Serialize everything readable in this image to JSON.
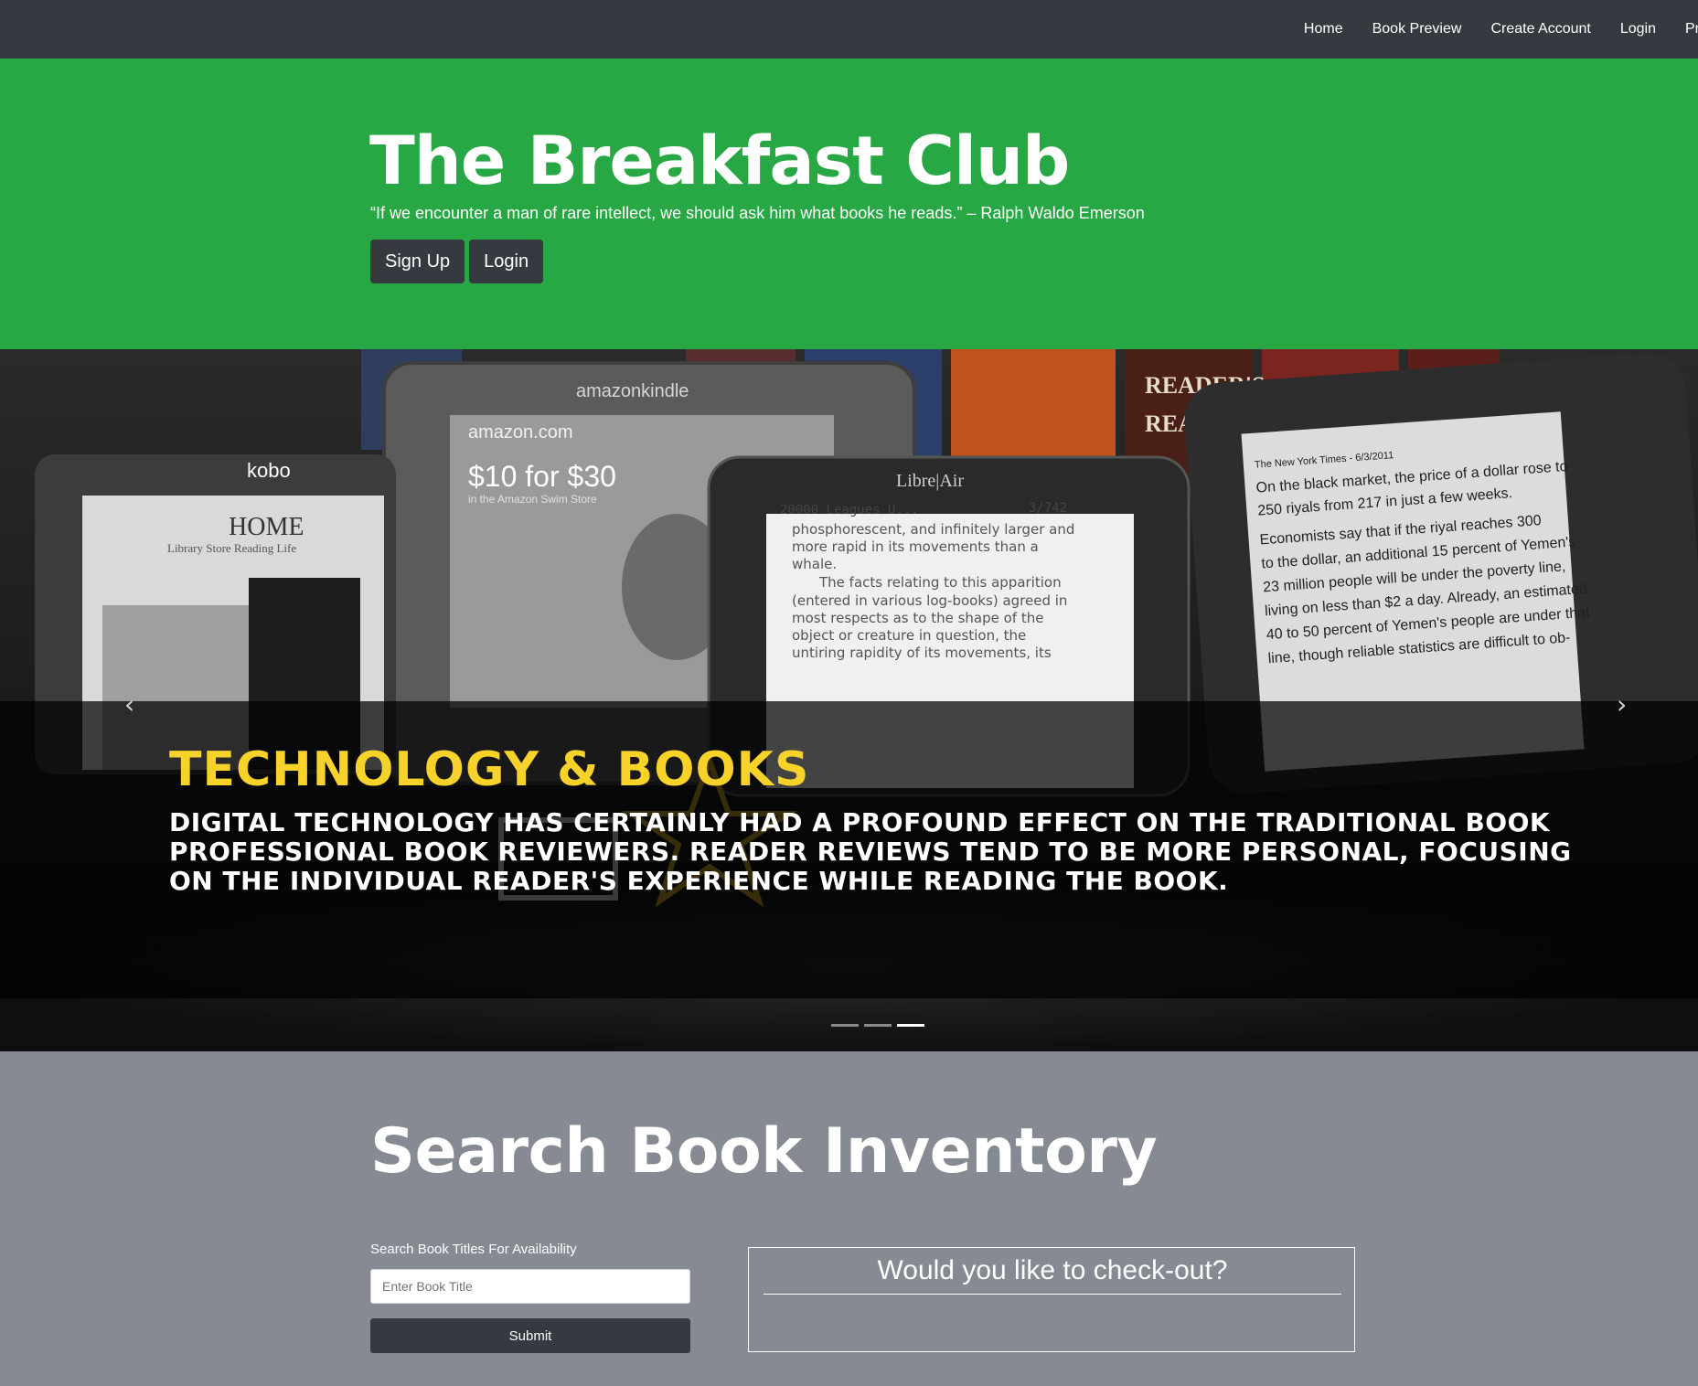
{
  "nav": {
    "items": [
      "Home",
      "Book Preview",
      "Create Account",
      "Login",
      "Pr"
    ]
  },
  "hero": {
    "title": "The Breakfast Club",
    "quote": "“If we encounter a man of rare intellect, we should ask him what books he reads.” – Ralph Waldo Emerson",
    "signup_label": "Sign Up",
    "login_label": "Login"
  },
  "carousel": {
    "caption_title": "TECHNOLOGY & BOOKS",
    "caption_text": "DIGITAL TECHNOLOGY HAS CERTAINLY HAD A PROFOUND EFFECT ON THE TRADITIONAL BOOK PROFESSIONAL BOOK REVIEWERS. READER REVIEWS TEND TO BE MORE PERSONAL, FOCUSING ON THE INDIVIDUAL READER'S EXPERIENCE WHILE READING THE BOOK.",
    "prev_icon": "‹",
    "next_icon": "›",
    "slide_count": 3,
    "active_slide": 3,
    "image_text": {
      "kindle_brand": "amazonkindle",
      "kindle_store": "amazon.com",
      "kindle_offer": "$10 for $30",
      "kindle_sub": "in the Amazon Swim Store",
      "kobo_brand": "kobo",
      "kobo_home": "HOME",
      "kobo_menu": "Library    Store    Reading Life",
      "libre_brand": "Libre|Air",
      "libre_header": "20000 Leagues U...",
      "libre_page": "3/742",
      "libre_line1": "phosphorescent, and infinitely larger and",
      "libre_line2": "more rapid in its movements than a",
      "libre_line3": "whale.",
      "libre_line4": "The facts relating to this apparition",
      "libre_line5": "(entered in various log-books) agreed in",
      "libre_line6": "most respects as to the shape of the",
      "libre_line7": "object or creature in question, the",
      "libre_line8": "untiring rapidity of its movements, its",
      "nook_header": "The New York Times - 6/3/2011",
      "nook_line1": "On the black market, the price of a dollar rose to",
      "nook_line2": "250 riyals from 217 in just a few weeks.",
      "nook_line3": "Economists say that if the riyal reaches 300",
      "nook_line4": "to the dollar, an additional 15 percent of Yemen's",
      "nook_line5": "23 million people will be under the poverty line,",
      "nook_line6": "living on less than $2 a day. Already, an estimated",
      "nook_line7": "40 to 50 percent of Yemen's people are under that",
      "nook_line8": "line, though reliable statistics are difficult to ob-",
      "readers_digest": "READER'S DIGEST"
    }
  },
  "search": {
    "heading": "Search Book Inventory",
    "label": "Search Book Titles For Availability",
    "placeholder": "Enter Book Title",
    "submit_label": "Submit"
  },
  "checkout": {
    "title": "Would you like to check-out?"
  }
}
